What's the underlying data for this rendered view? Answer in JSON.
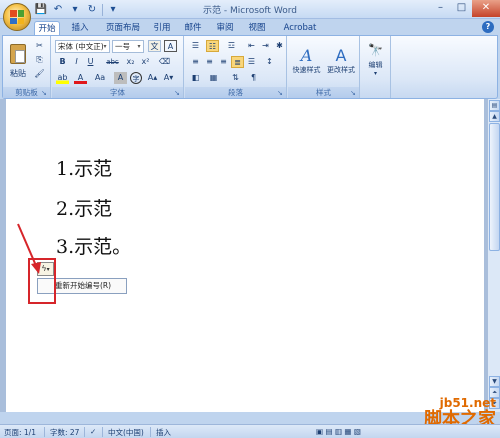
{
  "window": {
    "title": "示范 - Microsoft Word"
  },
  "tabs": [
    {
      "label": "开始"
    },
    {
      "label": "插入"
    },
    {
      "label": "页面布局"
    },
    {
      "label": "引用"
    },
    {
      "label": "邮件"
    },
    {
      "label": "审阅"
    },
    {
      "label": "视图"
    },
    {
      "label": "Acrobat"
    }
  ],
  "ribbon": {
    "clipboard": {
      "label": "剪贴板",
      "paste": "粘贴"
    },
    "font": {
      "label": "字体",
      "font_name": "宋体 (中文正)",
      "font_size": "一号",
      "wen": "文",
      "A_box": "A",
      "bold": "B",
      "italic": "I",
      "underline": "U",
      "strike": "abc",
      "sub": "x₂",
      "sup": "x²",
      "aa": "Aa",
      "A": "A",
      "circle": "字"
    },
    "paragraph": {
      "label": "段落"
    },
    "styles": {
      "label": "样式",
      "quick": "快速样式",
      "change": "更改样式"
    },
    "editing": {
      "label": "编辑"
    }
  },
  "document": {
    "lines": [
      "1.示范",
      "2.示范",
      "3.示范。"
    ],
    "smart_tag_menu": "重新开始编号(R)"
  },
  "status": {
    "page": "页面: 1/1",
    "words": "字数: 27",
    "lang": "中文(中国)",
    "mode": "插入"
  },
  "watermark": {
    "site": "jb51.net",
    "name": "脚本之家"
  },
  "colors": {
    "accent": "#15428b",
    "ribbon_bg": "#dbe7f7",
    "highlight": "#d6252a",
    "watermark": "#e06a00"
  }
}
